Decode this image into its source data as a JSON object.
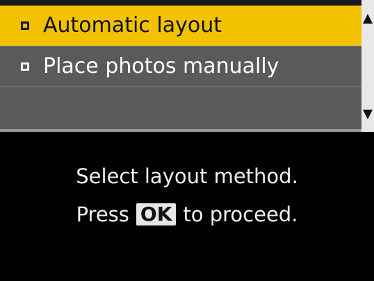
{
  "menu": {
    "items": [
      {
        "label": "Automatic layout",
        "selected": true
      },
      {
        "label": "Place photos manually",
        "selected": false
      },
      {
        "label": "",
        "selected": false
      }
    ]
  },
  "scrollbar": {
    "up_icon": "triangle-up-icon",
    "down_icon": "triangle-down-icon"
  },
  "message": {
    "line1": "Select layout method.",
    "line2_prefix": "Press",
    "ok_key": "OK",
    "line2_suffix": "to proceed."
  },
  "colors": {
    "selected_bg": "#f2c200",
    "menu_bg": "#5a5a5a",
    "screen_bg": "#000000",
    "text": "#f0f0f0"
  }
}
